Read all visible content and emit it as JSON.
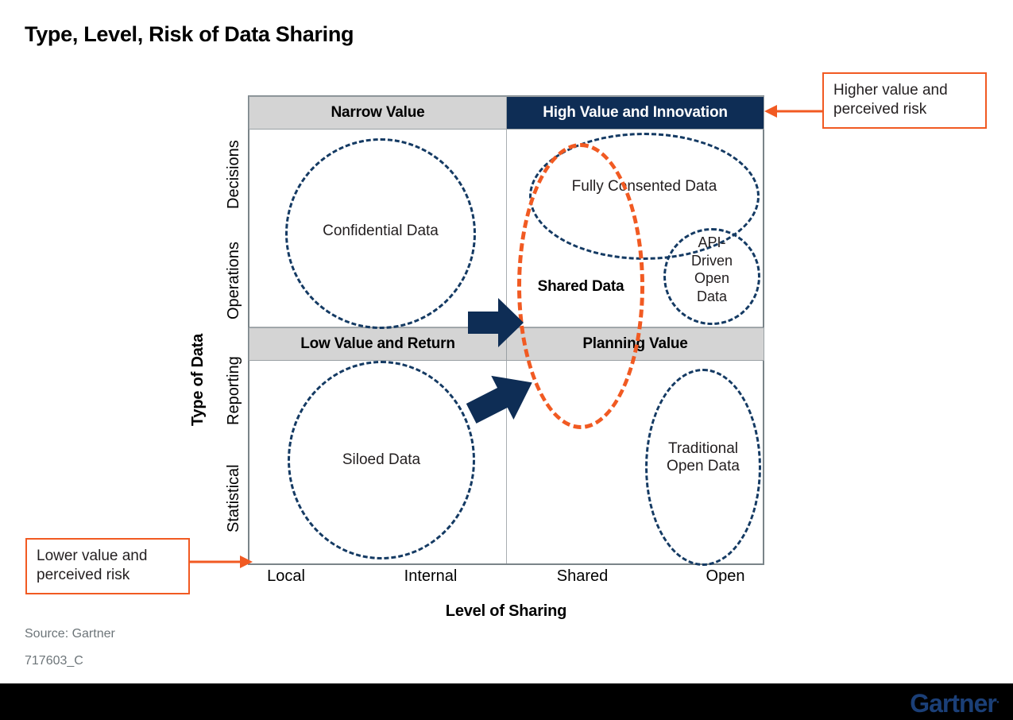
{
  "title": "Type, Level, Risk of Data Sharing",
  "source": {
    "label": "Source: Gartner",
    "doc_id": "717603_C"
  },
  "footer": {
    "logo_text": "Gartner",
    "logo_mark": "."
  },
  "axes": {
    "y_title": "Type of Data",
    "y_ticks": [
      "Decisions",
      "Operations",
      "Reporting",
      "Statistical"
    ],
    "x_title": "Level of Sharing",
    "x_ticks": [
      "Local",
      "Internal",
      "Shared",
      "Open"
    ]
  },
  "quadrants": [
    {
      "label": "Narrow Value",
      "style": "gray"
    },
    {
      "label": "High Value and Innovation",
      "style": "navy"
    },
    {
      "label": "Low Value and Return",
      "style": "gray"
    },
    {
      "label": "Planning Value",
      "style": "gray"
    }
  ],
  "bubbles": [
    {
      "label": "Confidential Data",
      "color": "navy"
    },
    {
      "label": "Fully Consented Data",
      "color": "navy"
    },
    {
      "label": "API-\nDriven\nOpen\nData",
      "color": "navy"
    },
    {
      "label": "Shared Data",
      "color": "orange"
    },
    {
      "label": "Siloed Data",
      "color": "navy"
    },
    {
      "label": "Traditional\nOpen Data",
      "color": "navy"
    }
  ],
  "callouts": [
    {
      "text": "Higher value and\nperceived risk"
    },
    {
      "text": "Lower value and\nperceived risk"
    }
  ],
  "colors": {
    "navy": "#0e2d55",
    "navy_dash": "#143a63",
    "orange": "#f15a22",
    "header_gray": "#d4d4d4",
    "frame_gray": "#7a8489",
    "footer_black": "#000000",
    "logo_blue": "#1b3f77"
  },
  "chart_data": {
    "type": "scatter",
    "title": "Type, Level, Risk of Data Sharing",
    "xlabel": "Level of Sharing",
    "ylabel": "Type of Data",
    "x_categories": [
      "Local",
      "Internal",
      "Shared",
      "Open"
    ],
    "y_categories": [
      "Statistical",
      "Reporting",
      "Operations",
      "Decisions"
    ],
    "grid": true,
    "legend": "none",
    "quadrant_labels": {
      "top_left": "Narrow Value",
      "top_right": "High Value and Innovation",
      "bottom_left": "Low Value and Return",
      "bottom_right": "Planning Value"
    },
    "items": [
      {
        "name": "Confidential Data",
        "quadrant": "top_left",
        "x_span": [
          "Local",
          "Internal"
        ],
        "y_span": [
          "Operations",
          "Decisions"
        ],
        "shape": "circle",
        "color": "#143a63"
      },
      {
        "name": "Fully Consented Data",
        "quadrant": "top_right",
        "x_span": [
          "Shared",
          "Open"
        ],
        "y_span": [
          "Decisions"
        ],
        "shape": "ellipse",
        "color": "#143a63"
      },
      {
        "name": "API-Driven Open Data",
        "quadrant": "top_right",
        "x_span": [
          "Open"
        ],
        "y_span": [
          "Operations"
        ],
        "shape": "circle",
        "color": "#143a63"
      },
      {
        "name": "Shared Data",
        "quadrant": "top_right/bottom_right",
        "x_span": [
          "Shared"
        ],
        "y_span": [
          "Reporting",
          "Decisions"
        ],
        "shape": "ellipse",
        "color": "#f15a22"
      },
      {
        "name": "Siloed Data",
        "quadrant": "bottom_left",
        "x_span": [
          "Local",
          "Internal"
        ],
        "y_span": [
          "Statistical",
          "Reporting"
        ],
        "shape": "circle",
        "color": "#143a63"
      },
      {
        "name": "Traditional Open Data",
        "quadrant": "bottom_right",
        "x_span": [
          "Open"
        ],
        "y_span": [
          "Statistical",
          "Reporting"
        ],
        "shape": "ellipse",
        "color": "#143a63"
      }
    ],
    "arrows": [
      {
        "from": "Confidential Data",
        "to": "Shared Data",
        "direction": "right",
        "color": "#0e2d55"
      },
      {
        "from": "Siloed Data",
        "to": "Shared Data",
        "direction": "up-right",
        "color": "#0e2d55"
      }
    ],
    "annotations": [
      {
        "text": "Higher value and perceived risk",
        "points_to": "top_right quadrant",
        "color": "#f15a22"
      },
      {
        "text": "Lower value and perceived risk",
        "points_to": "bottom_left origin",
        "color": "#f15a22"
      }
    ]
  }
}
